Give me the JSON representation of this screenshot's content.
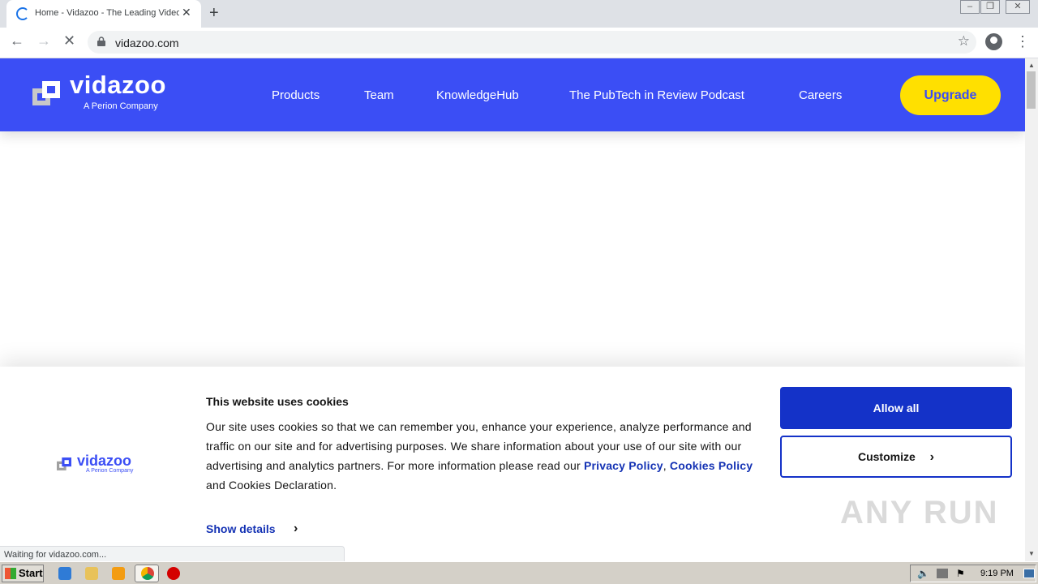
{
  "browser": {
    "tab_title": "Home - Vidazoo - The Leading Video",
    "url": "vidazoo.com",
    "status_text": "Waiting for vidazoo.com..."
  },
  "site": {
    "logo_text": "vidazoo",
    "logo_subtitle": "A Perion Company",
    "nav": [
      "Products",
      "Team",
      "KnowledgeHub",
      "The PubTech in Review Podcast",
      "Careers"
    ],
    "cta": "Upgrade",
    "brand_color": "#3b4ef5",
    "cta_color": "#ffe000"
  },
  "cookie": {
    "logo_text": "vidazoo",
    "logo_subtitle": "A Perion Company",
    "title": "This website uses cookies",
    "body_part1": "Our site uses cookies so that we can remember you, enhance your experience, analyze performance and traffic on our site and for advertising purposes. We share information about your use of our site with our advertising and analytics partners. For more information please read our ",
    "privacy_link": "Privacy Policy",
    "separator": ", ",
    "cookies_link": "Cookies Policy",
    "body_part2": " and Cookies Declaration.",
    "show_details": "Show details",
    "allow_all": "Allow all",
    "customize": "Customize"
  },
  "watermark": "ANY RUN",
  "taskbar": {
    "start": "Start",
    "clock": "9:19 PM"
  }
}
